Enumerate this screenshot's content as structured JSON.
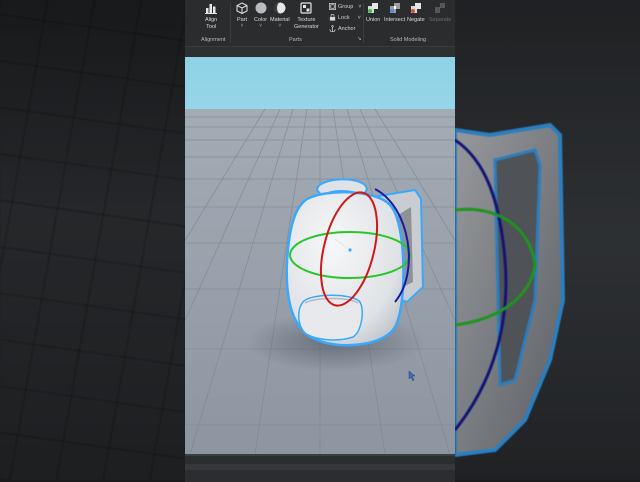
{
  "toolbar": {
    "alignment": {
      "align_tool_label": "Align\nTool",
      "group_label": "Alignment"
    },
    "parts": {
      "part_label": "Part",
      "color_label": "Color",
      "material_label": "Material",
      "texture_label": "Texture\nGenerator",
      "group_menu_label": "Group",
      "lock_label": "Lock",
      "anchor_label": "Anchor",
      "group_label": "Parts",
      "expand_glyph": "↘"
    },
    "solid_modeling": {
      "union_label": "Union",
      "intersect_label": "Intersect",
      "negate_label": "Negate",
      "separate_label": "Separate",
      "group_label": "Solid Modeling"
    },
    "caret": "˅"
  },
  "colors": {
    "selection_outline": "#3aa8ff",
    "rotate_y_ring": "#2bc52b",
    "rotate_x_ring": "#d01818",
    "rotate_z_ring": "#1a1a9e",
    "backpack": "#e9ebee",
    "baseplate": "#9ea6b0"
  },
  "icons": {
    "align": "align-tool-icon",
    "part": "cube-icon",
    "color": "color-circle-icon",
    "material": "material-sphere-icon",
    "texture": "texture-generator-icon",
    "group": "group-icon",
    "lock": "lock-icon",
    "anchor": "anchor-icon",
    "union": "union-icon",
    "intersect": "intersect-icon",
    "negate": "negate-icon",
    "separate": "separate-icon",
    "cursor": "mouse-cursor-icon"
  }
}
